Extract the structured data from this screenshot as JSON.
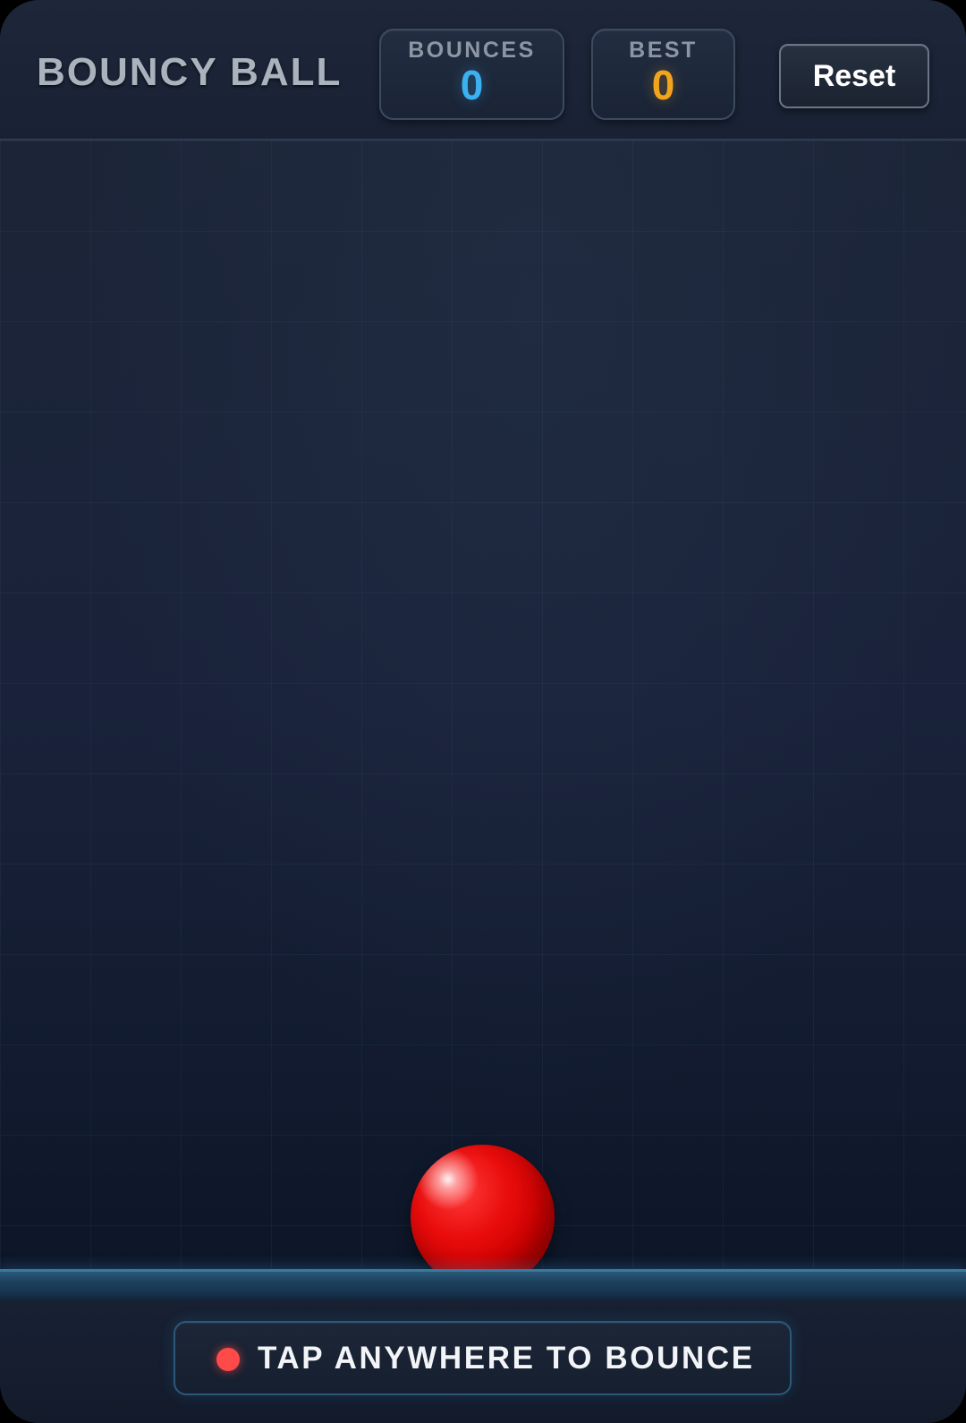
{
  "header": {
    "title": "BOUNCY BALL",
    "bounces_label": "BOUNCES",
    "bounces_value": "0",
    "best_label": "BEST",
    "best_value": "0",
    "reset_label": "Reset"
  },
  "footer": {
    "hint": "TAP ANYWHERE TO BOUNCE"
  },
  "colors": {
    "bounces_accent": "#3cb1f0",
    "best_accent": "#f2a51c",
    "ball": "#e90c0c",
    "floor": "#3a78a0"
  }
}
